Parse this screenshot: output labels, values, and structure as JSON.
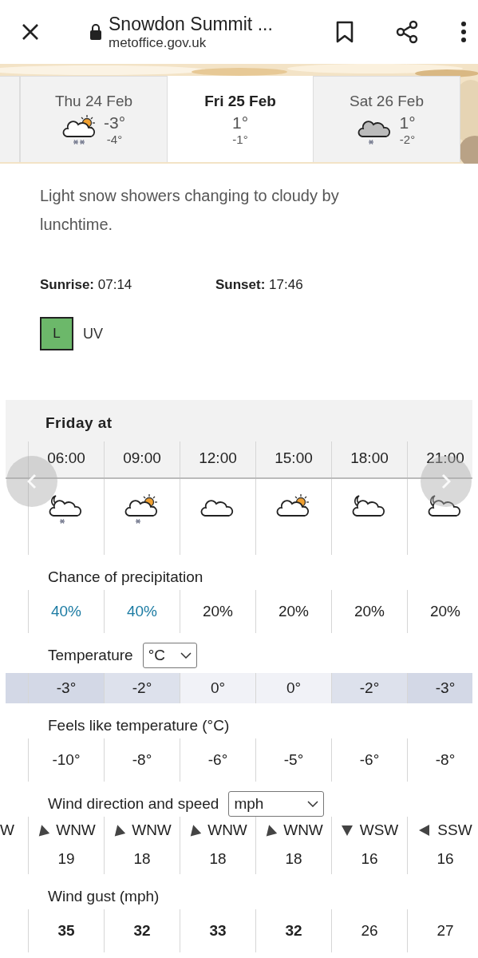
{
  "browser_bar": {
    "title": "Snowdon Summit ...",
    "url": "metoffice.gov.uk"
  },
  "days": [
    {
      "label": "Thu 24 Feb",
      "high": "-3°",
      "low": "-4°",
      "icon": {
        "kind": "sun_cloud_snow_heavy"
      },
      "selected": false
    },
    {
      "label": "Fri 25 Feb",
      "high": "1°",
      "low": "-1°",
      "selected": true
    },
    {
      "label": "Sat 26 Feb",
      "high": "1°",
      "low": "-2°",
      "icon": {
        "kind": "grey_cloud_snow"
      },
      "selected": false
    }
  ],
  "summary": "Light snow showers changing to cloudy by lunchtime.",
  "sunrise": "**Sunrise:** 07:14",
  "sunset": "**Sunset:** 17:46",
  "uv": {
    "code": "L",
    "label": "UV"
  },
  "hourly": {
    "heading": "Friday at",
    "times": [
      "06:00",
      "09:00",
      "12:00",
      "15:00",
      "18:00",
      "21:00"
    ],
    "icons": [
      {
        "kind": "moon_cloud_snow"
      },
      {
        "kind": "sun_cloud_snow"
      },
      {
        "kind": "cloud"
      },
      {
        "kind": "sun_cloud"
      },
      {
        "kind": "moon_cloud"
      },
      {
        "kind": "moon_cloud"
      }
    ],
    "precipitation": {
      "label": "Chance of precipitation",
      "values": [
        {
          "value": "40%",
          "highlighted": true
        },
        {
          "value": "40%",
          "highlighted": true
        },
        {
          "value": "20%",
          "highlighted": false
        },
        {
          "value": "20%",
          "highlighted": false
        },
        {
          "value": "20%",
          "highlighted": false
        },
        {
          "value": "20%",
          "highlighted": false
        }
      ]
    },
    "temperature": {
      "label": "Temperature",
      "unit": "°C",
      "values": [
        {
          "value": "-3°",
          "color": "#d3d8e6"
        },
        {
          "value": "-2°",
          "color": "#dde1ec"
        },
        {
          "value": "0°",
          "color": "#f1f2f7"
        },
        {
          "value": "0°",
          "color": "#f1f2f7"
        },
        {
          "value": "-2°",
          "color": "#dde1ec"
        },
        {
          "value": "-3°",
          "color": "#d3d8e6"
        }
      ]
    },
    "feels_like": {
      "label": "Feels like temperature (°C)",
      "values": [
        "-10°",
        "-8°",
        "-6°",
        "-5°",
        "-6°",
        "-8°"
      ]
    },
    "wind": {
      "label": "Wind direction and speed",
      "unit": "mph",
      "partial_direction": "W",
      "values": [
        {
          "direction": "WNW",
          "arrow": {
            "kind": "upward"
          },
          "speed": "19"
        },
        {
          "direction": "WNW",
          "arrow": {
            "kind": "upward"
          },
          "speed": "18"
        },
        {
          "direction": "WNW",
          "arrow": {
            "kind": "upward"
          },
          "speed": "18"
        },
        {
          "direction": "WNW",
          "arrow": {
            "kind": "upward"
          },
          "speed": "18"
        },
        {
          "direction": "WSW",
          "arrow": {
            "kind": "downward"
          },
          "speed": "16"
        },
        {
          "direction": "SSW",
          "arrow": {
            "kind": "leftward"
          },
          "speed": "16"
        }
      ]
    },
    "gust": {
      "label": "Wind gust (mph)",
      "values": [
        {
          "value": "35",
          "emphasized": true
        },
        {
          "value": "32",
          "emphasized": true
        },
        {
          "value": "33",
          "emphasized": true
        },
        {
          "value": "32",
          "emphasized": true
        },
        {
          "value": "26",
          "emphasized": false
        },
        {
          "value": "27",
          "emphasized": false
        }
      ]
    }
  }
}
